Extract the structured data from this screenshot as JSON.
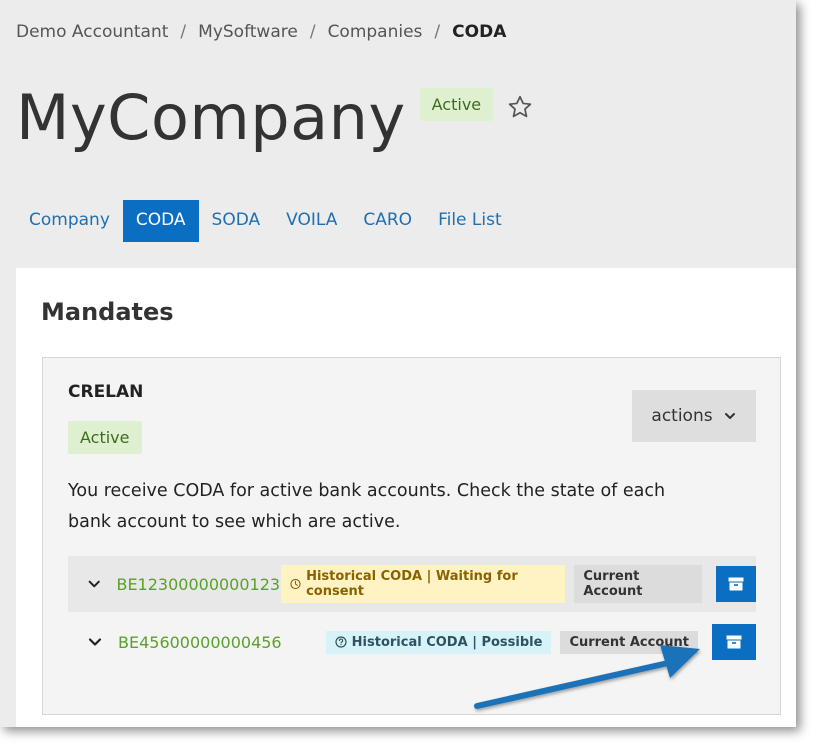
{
  "breadcrumb": {
    "items": [
      "Demo Accountant",
      "MySoftware",
      "Companies"
    ],
    "current": "CODA",
    "separator": "/"
  },
  "header": {
    "title": "MyCompany",
    "status": "Active",
    "star_icon": "star-outline-icon"
  },
  "tabs": [
    {
      "label": "Company",
      "active": false
    },
    {
      "label": "CODA",
      "active": true
    },
    {
      "label": "SODA",
      "active": false
    },
    {
      "label": "VOILA",
      "active": false
    },
    {
      "label": "CARO",
      "active": false
    },
    {
      "label": "File List",
      "active": false
    }
  ],
  "mandates": {
    "section_title": "Mandates",
    "bank": {
      "name": "CRELAN",
      "status": "Active",
      "actions_label": "actions",
      "description": "You receive CODA for active bank accounts. Check the state of each bank account to see which are active.",
      "accounts": [
        {
          "iban": "BE12300000000123",
          "historical": "Historical CODA | Waiting for consent",
          "historical_icon": "clock-icon",
          "type": "Current Account",
          "archive_icon": "archive-icon"
        },
        {
          "iban": "BE45600000000456",
          "historical": "Historical CODA | Possible",
          "historical_icon": "question-circle-icon",
          "type": "Current Account",
          "archive_icon": "archive-icon"
        }
      ]
    }
  },
  "colors": {
    "primary": "#0a6fc2",
    "link": "#1f6fb0",
    "iban": "#5aa02c",
    "active_bg": "#dff0d0",
    "waiting_bg": "#fff3c4",
    "possible_bg": "#d7f3f7",
    "annotation_arrow": "#1a72b8"
  }
}
